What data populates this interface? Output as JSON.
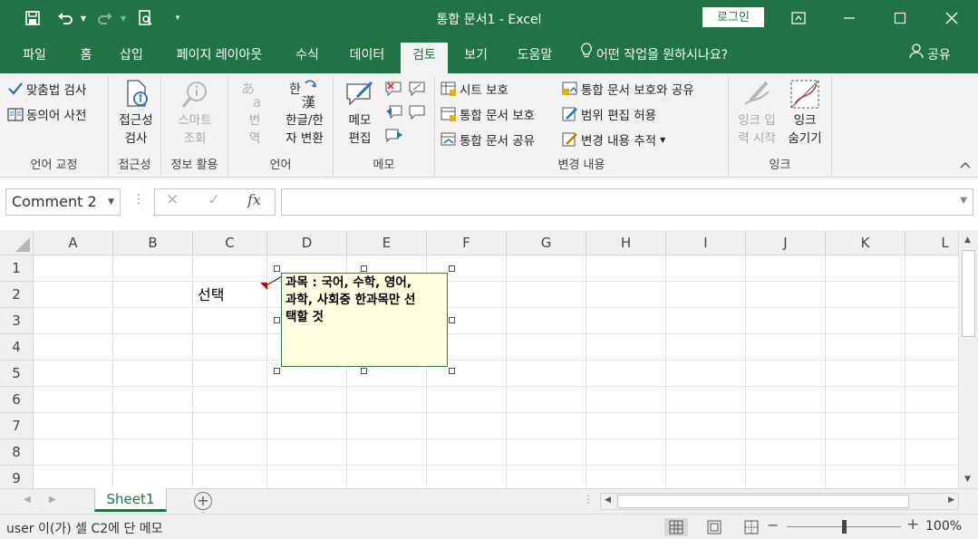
{
  "titlebar": {
    "title": "통합 문서1  -  Excel",
    "login": "로그인",
    "qat_icons": [
      "save-icon",
      "undo-icon",
      "redo-icon",
      "print-preview-icon",
      "customize-qat-icon"
    ],
    "window_icons": [
      "ribbon-display-icon",
      "minimize-icon",
      "maximize-icon",
      "close-icon"
    ]
  },
  "tabs": [
    {
      "label": "파일"
    },
    {
      "label": "홈"
    },
    {
      "label": "삽입"
    },
    {
      "label": "페이지 레이아웃"
    },
    {
      "label": "수식"
    },
    {
      "label": "데이터"
    },
    {
      "label": "검토"
    },
    {
      "label": "보기"
    },
    {
      "label": "도움말"
    }
  ],
  "tell_me": "어떤 작업을 원하시나요?",
  "share": "공유",
  "ribbon": {
    "proofing": {
      "spelling": "맞춤법 검사",
      "thesaurus": "동의어 사전",
      "label": "언어 교정"
    },
    "accessibility": {
      "button_line1": "접근성",
      "button_line2": "검사",
      "label": "접근성"
    },
    "insights": {
      "button_line1": "스마트",
      "button_line2": "조회",
      "label": "정보 활용"
    },
    "language": {
      "translate_line1": "번",
      "translate_line2": "역",
      "hanja_line1": "한글/한",
      "hanja_line2": "자 변환",
      "label": "언어"
    },
    "comments": {
      "button_line1": "메모",
      "button_line2": "편집",
      "label": "메모"
    },
    "changes": {
      "protect_sheet": "시트 보호",
      "protect_workbook": "통합 문서 보호",
      "share_workbook": "통합 문서 공유",
      "protect_share": "통합 문서 보호와 공유",
      "allow_edit_ranges": "범위 편집 허용",
      "track_changes": "변경 내용 추적",
      "label": "변경 내용"
    },
    "ink": {
      "start_line1": "잉크 입",
      "start_line2": "력 시작",
      "hide_line1": "잉크",
      "hide_line2": "숨기기",
      "label": "잉크"
    }
  },
  "formula_bar": {
    "name_box": "Comment 2",
    "fx": "fx",
    "value": ""
  },
  "grid": {
    "columns": [
      "A",
      "B",
      "C",
      "D",
      "E",
      "F",
      "G",
      "H",
      "I",
      "J",
      "K",
      "L"
    ],
    "rows": [
      "1",
      "2",
      "3",
      "4",
      "5",
      "6",
      "7",
      "8",
      "9"
    ],
    "cells": {
      "C2": "선택"
    },
    "comment": {
      "line1": "과목 : 국어, 수학, 영어,",
      "line2": "과학, 사회중 한과목만 선",
      "line3": "택할 것"
    }
  },
  "sheets": [
    {
      "name": "Sheet1"
    }
  ],
  "status": {
    "text": "user 이(가) 셀 C2에 단 메모",
    "zoom": "100%",
    "zoom_level": 1.0
  },
  "colors": {
    "brand": "#217346",
    "comment_bg": "#ffffe1",
    "comment_indicator": "#d00000"
  }
}
